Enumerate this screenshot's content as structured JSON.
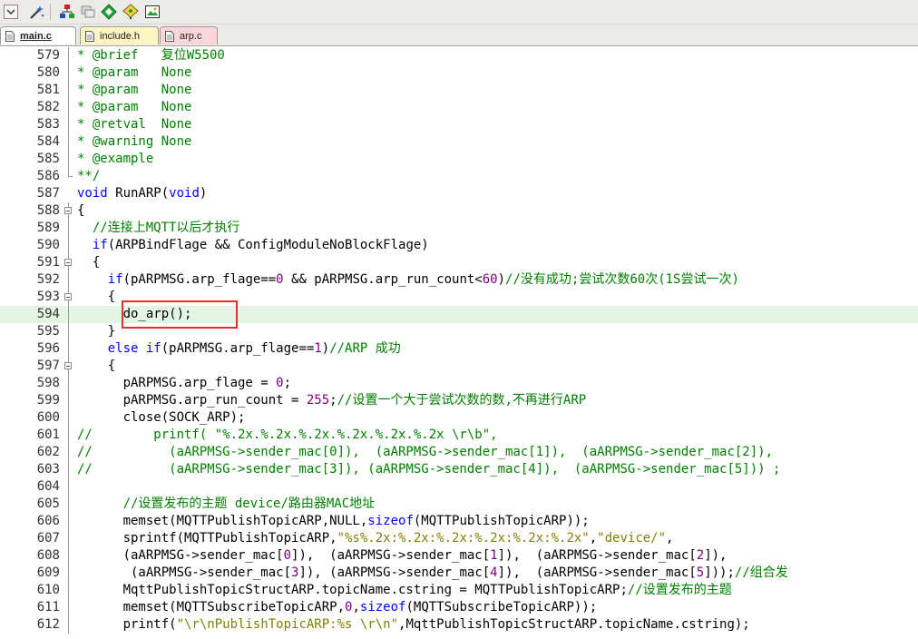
{
  "toolbar": {
    "icons": [
      "dropdown-arrow-icon",
      "magic-wand-icon",
      "build-target-icon",
      "windows-icon",
      "diamond-debug-icon",
      "tree-icon",
      "insert-image-icon"
    ]
  },
  "tabs": [
    {
      "label": "main.c",
      "active": true,
      "color": "#ffffff"
    },
    {
      "label": "include.h",
      "active": false,
      "color": "#fff5c2"
    },
    {
      "label": "arp.c",
      "active": false,
      "color": "#fbd6d9"
    }
  ],
  "editor": {
    "current_line": 594,
    "lines": [
      {
        "num": "579",
        "text": "* @brief   复位W5500"
      },
      {
        "num": "580",
        "text": "* @param   None"
      },
      {
        "num": "581",
        "text": "* @param   None"
      },
      {
        "num": "582",
        "text": "* @param   None"
      },
      {
        "num": "583",
        "text": "* @retval  None"
      },
      {
        "num": "584",
        "text": "* @warning None"
      },
      {
        "num": "585",
        "text": "* @example"
      },
      {
        "num": "586",
        "text": "**/"
      },
      {
        "num": "587",
        "text": "void RunARP(void)"
      },
      {
        "num": "588",
        "text": "{"
      },
      {
        "num": "589",
        "text": "  //连接上MQTT以后才执行"
      },
      {
        "num": "590",
        "text": "  if(ARPBindFlage && ConfigModuleNoBlockFlage)"
      },
      {
        "num": "591",
        "text": "  {"
      },
      {
        "num": "592",
        "text": "    if(pARPMSG.arp_flage==0 && pARPMSG.arp_run_count<60)//没有成功;尝试次数60次(1S尝试一次)"
      },
      {
        "num": "593",
        "text": "    {"
      },
      {
        "num": "594",
        "text": "      do_arp();"
      },
      {
        "num": "595",
        "text": "    }"
      },
      {
        "num": "596",
        "text": "    else if(pARPMSG.arp_flage==1)//ARP 成功"
      },
      {
        "num": "597",
        "text": "    {"
      },
      {
        "num": "598",
        "text": "      pARPMSG.arp_flage = 0;"
      },
      {
        "num": "599",
        "text": "      pARPMSG.arp_run_count = 255;//设置一个大于尝试次数的数,不再进行ARP"
      },
      {
        "num": "600",
        "text": "      close(SOCK_ARP);"
      },
      {
        "num": "601",
        "text": "//        printf( \"%.2x.%.2x.%.2x.%.2x.%.2x.%.2x \\r\\b\","
      },
      {
        "num": "602",
        "text": "//          (aARPMSG->sender_mac[0]),  (aARPMSG->sender_mac[1]),  (aARPMSG->sender_mac[2]),"
      },
      {
        "num": "603",
        "text": "//          (aARPMSG->sender_mac[3]), (aARPMSG->sender_mac[4]),  (aARPMSG->sender_mac[5])) ;"
      },
      {
        "num": "604",
        "text": ""
      },
      {
        "num": "605",
        "text": "      //设置发布的主题 device/路由器MAC地址"
      },
      {
        "num": "606",
        "text": "      memset(MQTTPublishTopicARP,NULL,sizeof(MQTTPublishTopicARP));"
      },
      {
        "num": "607",
        "text": "      sprintf(MQTTPublishTopicARP,\"%s%.2x:%.2x:%.2x:%.2x:%.2x:%.2x\",\"device/\","
      },
      {
        "num": "608",
        "text": "      (aARPMSG->sender_mac[0]),  (aARPMSG->sender_mac[1]),  (aARPMSG->sender_mac[2]),"
      },
      {
        "num": "609",
        "text": "       (aARPMSG->sender_mac[3]), (aARPMSG->sender_mac[4]),  (aARPMSG->sender_mac[5]));//组合发"
      },
      {
        "num": "610",
        "text": "      MqttPublishTopicStructARP.topicName.cstring = MQTTPublishTopicARP;//设置发布的主题"
      },
      {
        "num": "611",
        "text": "      memset(MQTTSubscribeTopicARP,0,sizeof(MQTTSubscribeTopicARP));"
      },
      {
        "num": "612",
        "text": "      printf(\"\\r\\nPublishTopicARP:%s \\r\\n\",MqttPublishTopicStructARP.topicName.cstring);"
      }
    ]
  },
  "colors": {
    "comment": "#008000",
    "keyword": "#0000ff",
    "number": "#800080",
    "string": "#808000",
    "current_line_bg": "#e4f5e4",
    "highlight_box": "#e03030"
  }
}
